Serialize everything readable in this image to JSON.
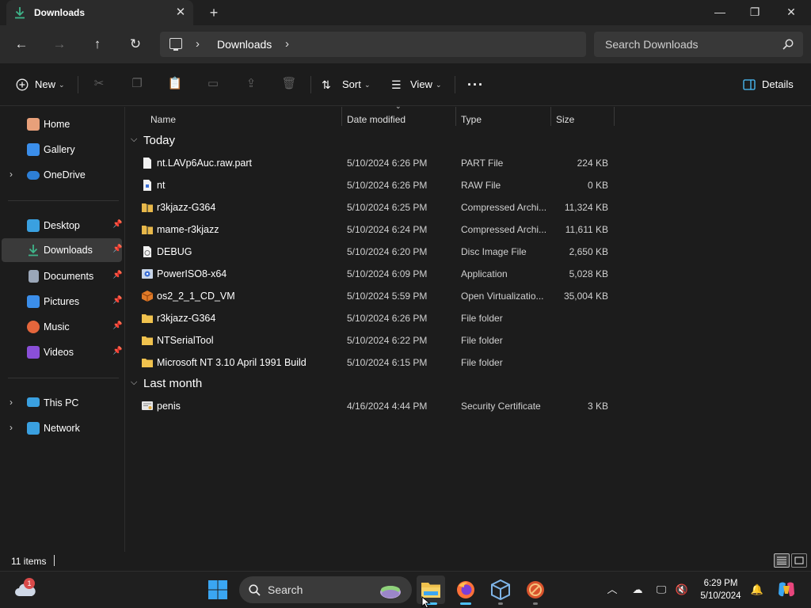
{
  "titlebar": {
    "tab_title": "Downloads",
    "tab_close": "✕",
    "new_tab": "+",
    "minimize": "—",
    "restore": "❐",
    "close": "✕"
  },
  "nav": {
    "back": "←",
    "forward": "→",
    "up": "↑",
    "refresh": "↻",
    "breadcrumb": "Downloads",
    "search_placeholder": "Search Downloads"
  },
  "commandbar": {
    "new_label": "New",
    "sort_label": "Sort",
    "view_label": "View",
    "more_label": "···",
    "details_label": "Details"
  },
  "sidebar": {
    "items": [
      {
        "label": "Home",
        "icon": "home-icon",
        "color": "#e8a07a"
      },
      {
        "label": "Gallery",
        "icon": "gallery-icon",
        "color": "#3b8eea"
      },
      {
        "label": "OneDrive",
        "icon": "onedrive-icon",
        "color": "#2d7fd6"
      },
      {
        "label": "Desktop",
        "icon": "desktop-icon",
        "color": "#3aa0e0"
      },
      {
        "label": "Downloads",
        "icon": "downloads-icon",
        "color": "#3fb58a"
      },
      {
        "label": "Documents",
        "icon": "documents-icon",
        "color": "#9aa6b8"
      },
      {
        "label": "Pictures",
        "icon": "pictures-icon",
        "color": "#3b8eea"
      },
      {
        "label": "Music",
        "icon": "music-icon",
        "color": "#e4663c"
      },
      {
        "label": "Videos",
        "icon": "videos-icon",
        "color": "#8a4fd8"
      },
      {
        "label": "This PC",
        "icon": "this-pc-icon",
        "color": "#3aa0e0"
      },
      {
        "label": "Network",
        "icon": "network-icon",
        "color": "#3aa0e0"
      }
    ]
  },
  "columns": {
    "name": "Name",
    "date": "Date modified",
    "type": "Type",
    "size": "Size"
  },
  "groups": {
    "today": "Today",
    "last_month": "Last month"
  },
  "files": [
    {
      "name": "nt.LAVp6Auc.raw.part",
      "date": "5/10/2024 6:26 PM",
      "type": "PART File",
      "size": "224 KB",
      "icon": "file-icon"
    },
    {
      "name": "nt",
      "date": "5/10/2024 6:26 PM",
      "type": "RAW File",
      "size": "0 KB",
      "icon": "raw-file-icon"
    },
    {
      "name": "r3kjazz-G364",
      "date": "5/10/2024 6:25 PM",
      "type": "Compressed Archi...",
      "size": "11,324 KB",
      "icon": "zip-folder-icon"
    },
    {
      "name": "mame-r3kjazz",
      "date": "5/10/2024 6:24 PM",
      "type": "Compressed Archi...",
      "size": "11,611 KB",
      "icon": "zip-folder-icon"
    },
    {
      "name": "DEBUG",
      "date": "5/10/2024 6:20 PM",
      "type": "Disc Image File",
      "size": "2,650 KB",
      "icon": "disc-image-icon"
    },
    {
      "name": "PowerISO8-x64",
      "date": "5/10/2024 6:09 PM",
      "type": "Application",
      "size": "5,028 KB",
      "icon": "application-icon"
    },
    {
      "name": "os2_2_1_CD_VM",
      "date": "5/10/2024 5:59 PM",
      "type": "Open Virtualizatio...",
      "size": "35,004 KB",
      "icon": "ova-package-icon"
    },
    {
      "name": "r3kjazz-G364",
      "date": "5/10/2024 6:26 PM",
      "type": "File folder",
      "size": "",
      "icon": "folder-icon"
    },
    {
      "name": "NTSerialTool",
      "date": "5/10/2024 6:22 PM",
      "type": "File folder",
      "size": "",
      "icon": "folder-icon"
    },
    {
      "name": "Microsoft NT 3.10 April 1991 Build",
      "date": "5/10/2024 6:15 PM",
      "type": "File folder",
      "size": "",
      "icon": "folder-icon"
    },
    {
      "name": "penis",
      "date": "4/16/2024 4:44 PM",
      "type": "Security Certificate",
      "size": "3 KB",
      "icon": "certificate-icon"
    }
  ],
  "status": {
    "item_count": "11 items"
  },
  "taskbar": {
    "search_label": "Search",
    "weather_badge": "1",
    "time": "6:29 PM",
    "date": "5/10/2024"
  }
}
